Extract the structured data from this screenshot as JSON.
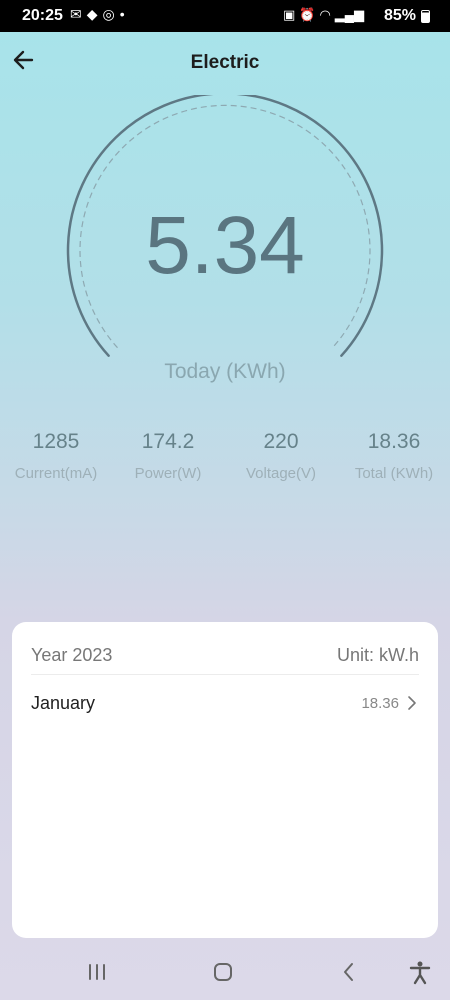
{
  "status_bar": {
    "time": "20:25",
    "battery": "85%",
    "left_icons": [
      "mail-icon",
      "gem-icon",
      "sync-icon",
      "dot-icon"
    ],
    "right_icons": [
      "nfc-icon",
      "alarm-icon",
      "wifi-icon",
      "signal-icon"
    ]
  },
  "header": {
    "title": "Electric",
    "back_icon": "arrow-left-icon"
  },
  "gauge": {
    "value": "5.34",
    "label": "Today (KWh)"
  },
  "stats": [
    {
      "value": "1285",
      "label": "Current(mA)"
    },
    {
      "value": "174.2",
      "label": "Power(W)"
    },
    {
      "value": "220",
      "label": "Voltage(V)"
    },
    {
      "value": "18.36",
      "label": "Total (KWh)"
    }
  ],
  "history": {
    "year_label": "Year 2023",
    "unit_label": "Unit: kW.h",
    "months": [
      {
        "name": "January",
        "value": "18.36"
      }
    ]
  },
  "nav": {
    "icons": [
      "recent-apps-icon",
      "home-icon",
      "back-icon",
      "accessibility-icon"
    ]
  },
  "colors": {
    "background_top": "#a7e4ea",
    "background_bottom": "#dcd9e9",
    "gauge_text": "#5a7580",
    "stat_text": "#66828a"
  }
}
